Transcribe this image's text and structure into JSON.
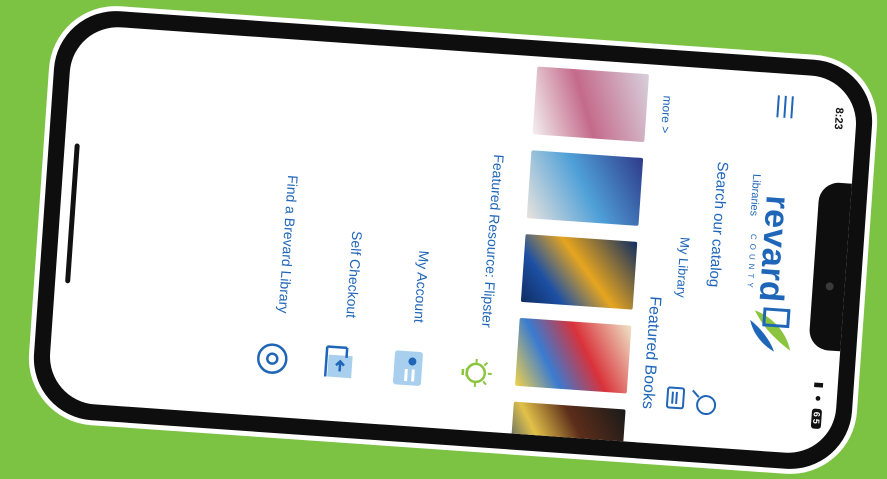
{
  "status": {
    "time": "8:23",
    "signal": "▮ ●",
    "battery": "65"
  },
  "header": {
    "brand": "revard",
    "county": "COUNTY",
    "libraries": "Libraries"
  },
  "search": {
    "label": "Search our catalog"
  },
  "my_library": {
    "label": "My Library"
  },
  "featured": {
    "title": "Featured Books",
    "more": "more >"
  },
  "menu": [
    {
      "label": "Featured Resource: Flipster"
    },
    {
      "label": "My Account"
    },
    {
      "label": "Self Checkout"
    },
    {
      "label": "Find a Brevard Library"
    }
  ],
  "colors": {
    "background": "#7cc243",
    "accent": "#1f66b8",
    "lightbulb": "#8bc53f"
  }
}
